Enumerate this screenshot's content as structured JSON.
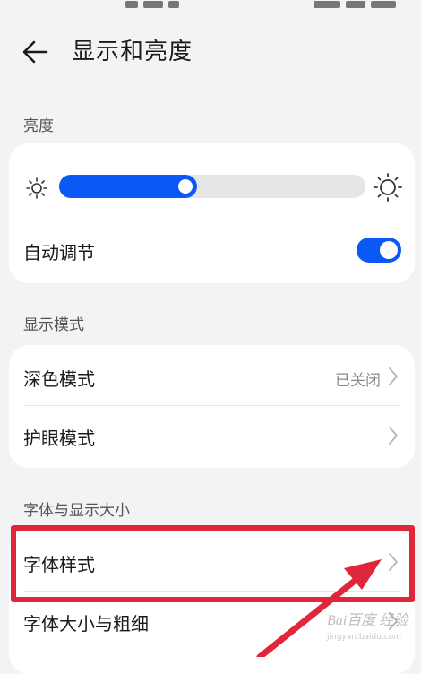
{
  "header": {
    "title": "显示和亮度",
    "back_icon": "arrow-left-icon"
  },
  "brightness": {
    "section_label": "亮度",
    "slider_level": 0.45,
    "auto_adjust_label": "自动调节",
    "auto_adjust_on": true
  },
  "display_mode": {
    "section_label": "显示模式",
    "items": [
      {
        "label": "深色模式",
        "value": "已关闭"
      },
      {
        "label": "护眼模式",
        "value": ""
      }
    ]
  },
  "font_display": {
    "section_label": "字体与显示大小",
    "items": [
      {
        "label": "字体样式"
      },
      {
        "label": "字体大小与粗细"
      }
    ]
  },
  "watermark": {
    "brand": "Bai百度 经验",
    "url": "jingyan.baidu.com"
  },
  "colors": {
    "accent": "#0a59f7",
    "highlight": "#e0263a",
    "background": "#f1f3f5"
  }
}
